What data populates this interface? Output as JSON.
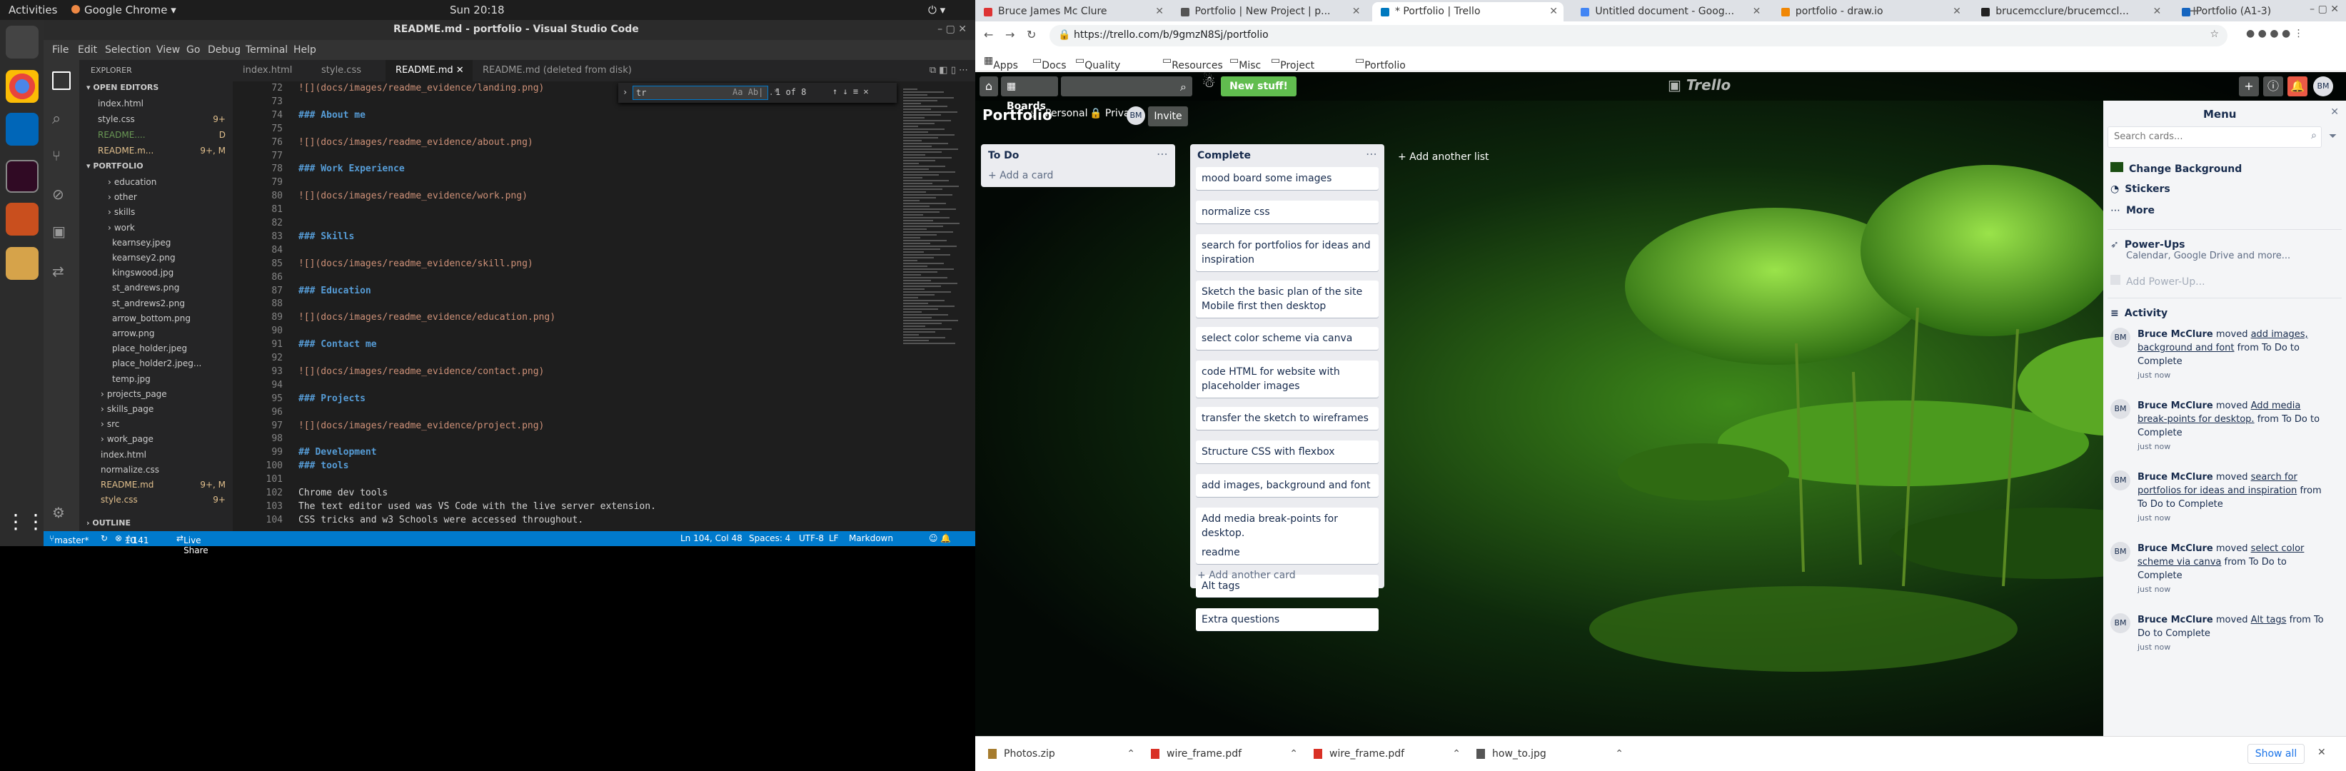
{
  "gnome": {
    "activities": "Activities",
    "app": "Google Chrome",
    "clock": "Sun 20:18"
  },
  "vscode": {
    "title": "README.md - portfolio - Visual Studio Code",
    "menu": [
      "File",
      "Edit",
      "Selection",
      "View",
      "Go",
      "Debug",
      "Terminal",
      "Help"
    ],
    "explorer_title": "EXPLORER",
    "open_editors_label": "OPEN EDITORS",
    "open_editors": [
      {
        "name": "index.html",
        "badge": ""
      },
      {
        "name": "style.css",
        "badge": "9+"
      },
      {
        "name": "README....",
        "badge": "D"
      },
      {
        "name": "README.m...",
        "badge": "9+, M"
      }
    ],
    "portfolio_label": "PORTFOLIO",
    "tree": [
      {
        "name": "education",
        "badge": ""
      },
      {
        "name": "other",
        "badge": ""
      },
      {
        "name": "skills",
        "badge": ""
      },
      {
        "name": "work",
        "badge": ""
      },
      {
        "name": "kearnsey.jpeg",
        "badge": ""
      },
      {
        "name": "kearnsey2.png",
        "badge": ""
      },
      {
        "name": "kingswood.jpg",
        "badge": ""
      },
      {
        "name": "st_andrews.png",
        "badge": ""
      },
      {
        "name": "st_andrews2.png",
        "badge": ""
      },
      {
        "name": "arrow_bottom.png",
        "badge": ""
      },
      {
        "name": "arrow.png",
        "badge": ""
      },
      {
        "name": "place_holder.jpeg",
        "badge": ""
      },
      {
        "name": "place_holder2.jpeg...",
        "badge": ""
      },
      {
        "name": "temp.jpg",
        "badge": ""
      },
      {
        "name": "projects_page",
        "badge": ""
      },
      {
        "name": "skills_page",
        "badge": ""
      },
      {
        "name": "src",
        "badge": ""
      },
      {
        "name": "work_page",
        "badge": ""
      },
      {
        "name": "index.html",
        "badge": ""
      },
      {
        "name": "normalize.css",
        "badge": ""
      },
      {
        "name": "README.md",
        "badge": "9+, M"
      },
      {
        "name": "style.css",
        "badge": "9+"
      }
    ],
    "outline_label": "OUTLINE",
    "tabs": [
      "index.html",
      "style.css",
      "README.md",
      "README.md (deleted from disk)"
    ],
    "find": {
      "value": "tr",
      "count": "1 of 8",
      "opt_case": "Aa",
      "opt_word": "Ab|",
      "opt_regex": ".*"
    },
    "lines": [
      {
        "n": "72",
        "t": "![](docs/images/readme_evidence/landing.png)"
      },
      {
        "n": "73",
        "t": ""
      },
      {
        "n": "74",
        "t": "### About me"
      },
      {
        "n": "75",
        "t": ""
      },
      {
        "n": "76",
        "t": "![](docs/images/readme_evidence/about.png)"
      },
      {
        "n": "77",
        "t": ""
      },
      {
        "n": "78",
        "t": "### Work Experience"
      },
      {
        "n": "79",
        "t": ""
      },
      {
        "n": "80",
        "t": "![](docs/images/readme_evidence/work.png)"
      },
      {
        "n": "81",
        "t": ""
      },
      {
        "n": "82",
        "t": ""
      },
      {
        "n": "83",
        "t": "### Skills"
      },
      {
        "n": "84",
        "t": ""
      },
      {
        "n": "85",
        "t": "![](docs/images/readme_evidence/skill.png)"
      },
      {
        "n": "86",
        "t": ""
      },
      {
        "n": "87",
        "t": "### Education"
      },
      {
        "n": "88",
        "t": ""
      },
      {
        "n": "89",
        "t": "![](docs/images/readme_evidence/education.png)"
      },
      {
        "n": "90",
        "t": ""
      },
      {
        "n": "91",
        "t": "### Contact me"
      },
      {
        "n": "92",
        "t": ""
      },
      {
        "n": "93",
        "t": "![](docs/images/readme_evidence/contact.png)"
      },
      {
        "n": "94",
        "t": ""
      },
      {
        "n": "95",
        "t": "### Projects"
      },
      {
        "n": "96",
        "t": ""
      },
      {
        "n": "97",
        "t": "![](docs/images/readme_evidence/project.png)"
      },
      {
        "n": "98",
        "t": ""
      },
      {
        "n": "99",
        "t": "## Development"
      },
      {
        "n": "100",
        "t": "### tools"
      },
      {
        "n": "101",
        "t": ""
      },
      {
        "n": "102",
        "t": "Chrome dev tools"
      },
      {
        "n": "103",
        "t": "The text editor used was VS Code with the live server extension."
      },
      {
        "n": "104",
        "t": "CSS tricks and w3 Schools were accessed throughout."
      }
    ],
    "status": {
      "branch": "master*",
      "problems": "10",
      "warnings": "141",
      "live_share": "Live Share",
      "position": "Ln 104, Col 48",
      "spaces": "Spaces: 4",
      "encoding": "UTF-8",
      "eol": "LF",
      "language": "Markdown"
    }
  },
  "chrome": {
    "tabs": [
      "Bruce James Mc Clure",
      "Portfolio | New Project | p...",
      "* Portfolio | Trello",
      "Untitled document - Goog...",
      "portfolio - draw.io",
      "brucemcclure/brucemccl...",
      "Portfolio (A1-3)"
    ],
    "url": "https://trello.com/b/9gmzN8Sj/portfolio",
    "bookmarks": [
      "Apps",
      "Docs",
      "Quality of life",
      "Resources",
      "Misc",
      "Project manag...",
      "Portfolio ideas"
    ]
  },
  "trello": {
    "boards_label": "Boards",
    "new_stuff": "New stuff!",
    "logo": "Trello",
    "board_name": "Portfolio",
    "team": "Personal",
    "visibility": "Private",
    "member_initials": "BM",
    "invite": "Invite",
    "lists": [
      {
        "title": "To Do",
        "add": "+ Add a card",
        "cards": []
      },
      {
        "title": "Complete",
        "add": "+ Add another card",
        "cards": [
          "mood board some images",
          "normalize css",
          "search for portfolios for ideas and inspiration",
          "Sketch the basic plan of the site Mobile first then desktop",
          "select color scheme via canva",
          "code HTML for website with placeholder images",
          "transfer the sketch to wireframes",
          "Structure CSS with flexbox",
          "add images, background and font",
          "Add media break-points for desktop.",
          "readme",
          "Alt tags",
          "Extra questions"
        ]
      }
    ],
    "add_list": "+ Add another list",
    "menu": {
      "title": "Menu",
      "search_placeholder": "Search cards...",
      "change_background": "Change Background",
      "stickers": "Stickers",
      "more": "More",
      "powerups_title": "Power-Ups",
      "powerups_sub": "Calendar, Google Drive and more...",
      "add_powerup": "Add Power-Up...",
      "activity_title": "Activity",
      "activity": [
        {
          "user": "Bruce McClure",
          "verb": "moved",
          "card": "add images, background and font",
          "rest": "from To Do to Complete",
          "time": "just now"
        },
        {
          "user": "Bruce McClure",
          "verb": "moved",
          "card": "Add media break-points for desktop.",
          "rest": "from To Do to Complete",
          "time": "just now"
        },
        {
          "user": "Bruce McClure",
          "verb": "moved",
          "card": "search for portfolios for ideas and inspiration",
          "rest": "from To Do to Complete",
          "time": "just now"
        },
        {
          "user": "Bruce McClure",
          "verb": "moved",
          "card": "select color scheme via canva",
          "rest": "from To Do to Complete",
          "time": "just now"
        },
        {
          "user": "Bruce McClure",
          "verb": "moved",
          "card": "Alt tags",
          "rest": "from To Do to Complete",
          "time": "just now"
        }
      ]
    }
  },
  "downloads": {
    "items": [
      "Photos.zip",
      "wire_frame.pdf",
      "wire_frame.pdf",
      "how_to.jpg"
    ],
    "show_all": "Show all"
  },
  "colors": {
    "vscode_accent": "#007acc",
    "trello_green": "#61bd4f",
    "md_heading": "#569cd6",
    "md_link": "#ce9178"
  }
}
